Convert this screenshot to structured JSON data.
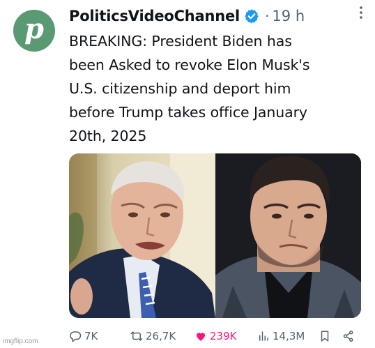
{
  "avatar": {
    "letter": "p",
    "color": "#5a9a73"
  },
  "author": {
    "name": "PoliticsVideoChannel",
    "verified": true,
    "verified_color": "#1d9bf0"
  },
  "meta": {
    "separator": "·",
    "time": "19 h"
  },
  "tweet": {
    "text": "BREAKING: President Biden has\nbeen Asked to revoke Elon Musk's\nU.S. citizenship and deport him\nbefore Trump takes office January\n20th, 2025"
  },
  "media": {
    "photos": [
      "photo-left",
      "photo-right"
    ]
  },
  "actions": {
    "replies": "7K",
    "reposts": "26,7K",
    "likes": "239K",
    "views": "14,3M",
    "like_color": "#f91880"
  },
  "watermark": "imgflip.com"
}
